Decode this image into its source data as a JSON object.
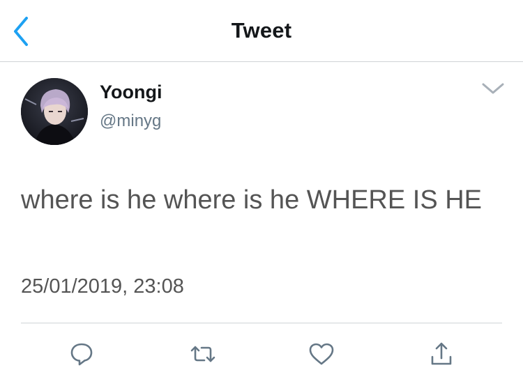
{
  "nav": {
    "title": "Tweet",
    "back_icon": "chevron-left-icon"
  },
  "author": {
    "display_name": "Yoongi",
    "handle": "@minyg",
    "avatar": "profile-photo"
  },
  "tweet": {
    "text": "where is he where is he WHERE IS HE",
    "timestamp": "25/01/2019, 23:08"
  },
  "actions": [
    {
      "icon": "reply-icon"
    },
    {
      "icon": "retweet-icon"
    },
    {
      "icon": "like-icon"
    },
    {
      "icon": "share-icon"
    }
  ],
  "colors": {
    "accent": "#1da1f2",
    "text": "#14171a",
    "secondary": "#657786",
    "icon": "#657786",
    "divider": "#cfd3d6"
  }
}
